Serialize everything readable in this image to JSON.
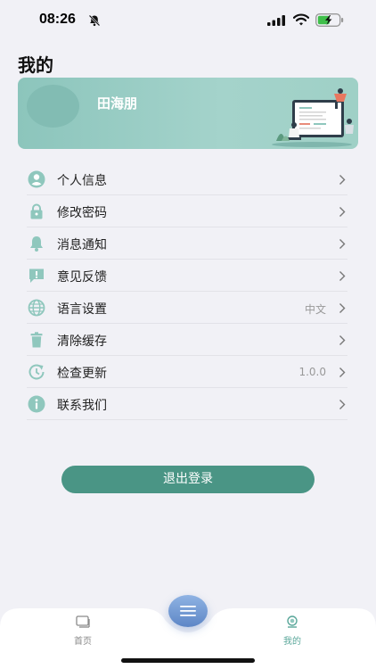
{
  "status_bar": {
    "time": "08:26"
  },
  "page": {
    "title": "我的"
  },
  "profile": {
    "name": "田海朋"
  },
  "menu": [
    {
      "label": "个人信息",
      "value": "",
      "icon": "user-icon"
    },
    {
      "label": "修改密码",
      "value": "",
      "icon": "lock-icon"
    },
    {
      "label": "消息通知",
      "value": "",
      "icon": "bell-icon"
    },
    {
      "label": "意见反馈",
      "value": "",
      "icon": "feedback-icon"
    },
    {
      "label": "语言设置",
      "value": "中文",
      "icon": "globe-icon"
    },
    {
      "label": "清除缓存",
      "value": "",
      "icon": "trash-icon"
    },
    {
      "label": "检查更新",
      "value": "1.0.0",
      "icon": "update-icon"
    },
    {
      "label": "联系我们",
      "value": "",
      "icon": "info-icon"
    }
  ],
  "logout": {
    "label": "退出登录"
  },
  "tabbar": {
    "home_label": "首页",
    "mine_label": "我的"
  },
  "colors": {
    "accent": "#4a9585",
    "icon": "#8fc7bd",
    "card": "#a4d3cb"
  }
}
